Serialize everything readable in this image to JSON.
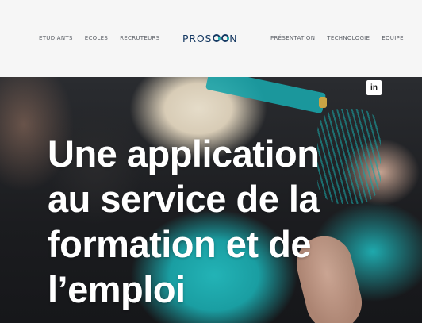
{
  "nav": {
    "left": [
      "ETUDIANTS",
      "ECOLES",
      "RECRUTEURS"
    ],
    "right": [
      "PRÉSENTATION",
      "TECHNOLOGIE",
      "EQUIPE"
    ]
  },
  "logo": {
    "text_before": "PROS",
    "text_after": "N"
  },
  "social": {
    "linkedin_label": "in"
  },
  "hero": {
    "headline_lines": [
      "Une application",
      "au service de la",
      "formation et de",
      "l’emploi"
    ]
  },
  "colors": {
    "background": "#f6f6f6",
    "nav_text": "#5b5f66",
    "logo_navy": "#173a63",
    "logo_teal": "#2cb5b6",
    "headline": "#ffffff"
  },
  "icons": {
    "linkedin": "linkedin-icon"
  }
}
